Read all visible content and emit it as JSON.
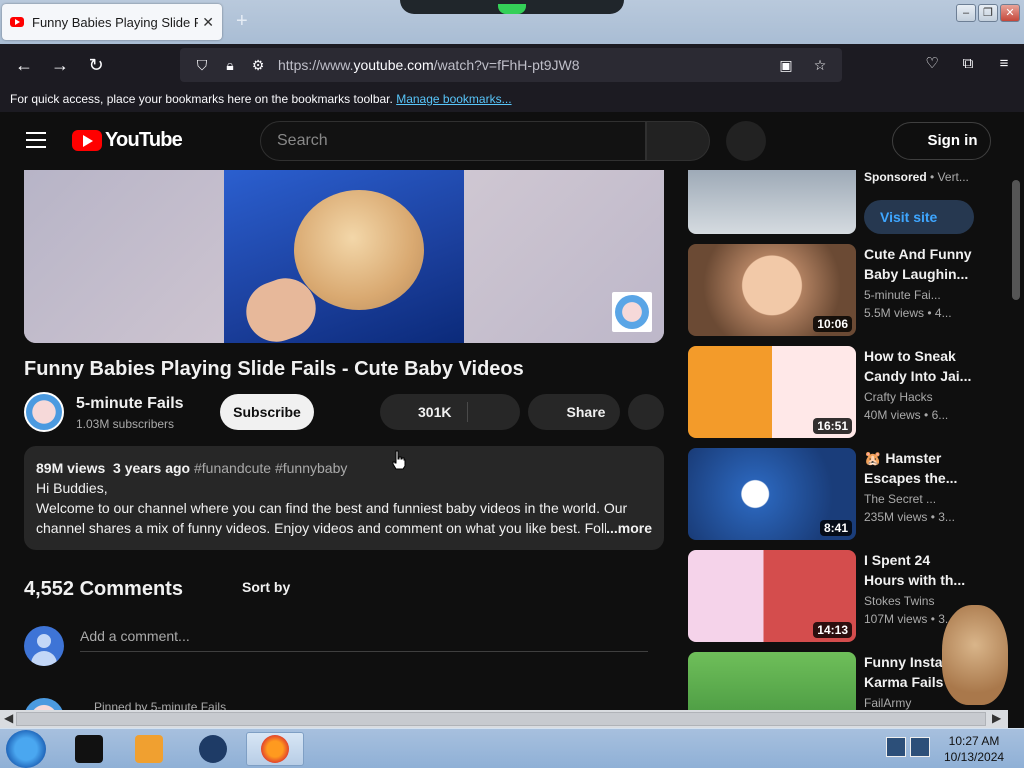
{
  "browser": {
    "tab_title": "Funny Babies Playing Slide Fails - Cute Baby Videos",
    "tab_close": "✕",
    "new_tab": "+",
    "url_prefix": "https://www.",
    "url_domain": "youtube.com",
    "url_path": "/watch?v=fFhH-pt9JW8",
    "bookmarks_text": "For quick access, place your bookmarks here on the bookmarks toolbar.",
    "bookmarks_link": "Manage bookmarks..."
  },
  "youtube": {
    "logo_text": "YouTube",
    "search_placeholder": "Search",
    "sign_in": "Sign in"
  },
  "video": {
    "title": "Funny Babies Playing Slide Fails - Cute Baby Videos",
    "channel": "5-minute Fails",
    "subscribers": "1.03M subscribers",
    "subscribe": "Subscribe",
    "likes": "301K",
    "share": "Share",
    "views": "89M views",
    "age": "3 years ago",
    "tags": "#funandcute #funnybaby",
    "desc_line1": "Hi Buddies,",
    "desc_line2": "Welcome to our channel where you can find the best and funniest baby videos in the world. Our",
    "desc_line3": "channel shares a mix of funny videos. Enjoy videos and comment on what you like best. Follow",
    "more": "...more"
  },
  "comments": {
    "count": "4,552 Comments",
    "sort": "Sort by",
    "add_placeholder": "Add a comment...",
    "pinned": "Pinned by 5-minute Fails"
  },
  "ad": {
    "sponsored": "Sponsored",
    "advertiser": "Vert...",
    "visit": "Visit site"
  },
  "recommendations": [
    {
      "title": "Cute And Funny Baby Laughin...",
      "channel": "5-minute Fai...",
      "views": "5.5M views",
      "age": "4...",
      "duration": "10:06"
    },
    {
      "title": "How to Sneak Candy Into Jai...",
      "channel": "Crafty Hacks",
      "views": "40M views",
      "age": "6...",
      "duration": "16:51"
    },
    {
      "title": "🐹 Hamster Escapes the...",
      "channel": "The Secret ...",
      "views": "235M views",
      "age": "3...",
      "duration": "8:41"
    },
    {
      "title": "I Spent 24 Hours with th...",
      "channel": "Stokes Twins",
      "views": "107M views",
      "age": "3...",
      "duration": "14:13"
    },
    {
      "title": "Funny Instan... Karma Fails",
      "channel": "FailArmy",
      "views": "",
      "age": "",
      "duration": ""
    }
  ],
  "taskbar": {
    "time": "10:27 AM",
    "date": "10/13/2024"
  }
}
